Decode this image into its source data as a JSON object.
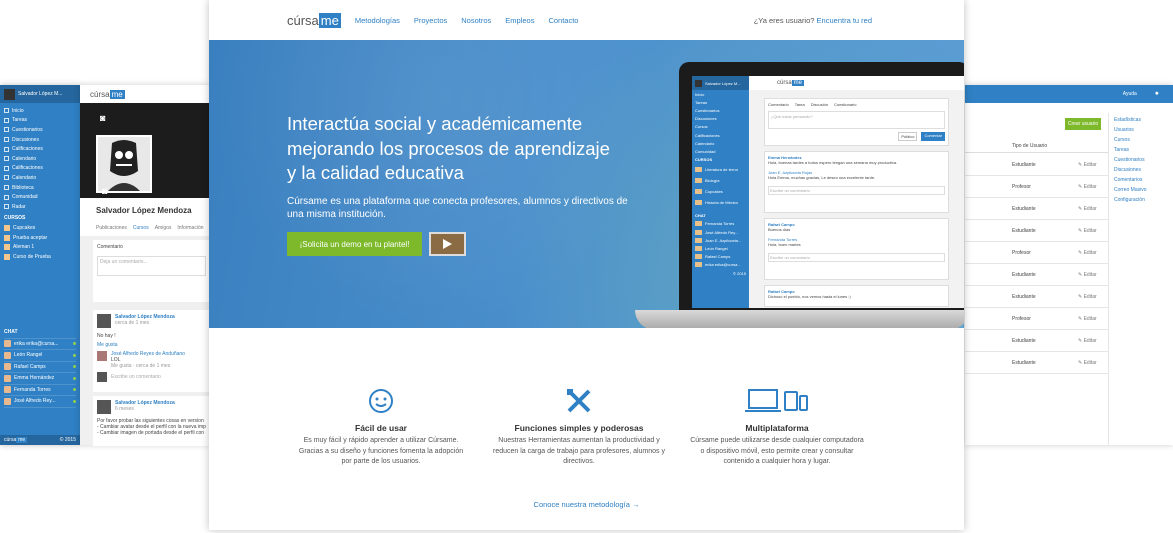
{
  "nav": {
    "logo_text": "cúrsa",
    "logo_badge": "me",
    "links": [
      "Metodologías",
      "Proyectos",
      "Nosotros",
      "Empleos",
      "Contacto"
    ],
    "question": "¿Ya eres usuario?",
    "login_link": "Encuentra tu red"
  },
  "hero": {
    "headline_1": "Interactúa social y académicamente",
    "headline_2": "mejorando los procesos de aprendizaje",
    "headline_3": "y la calidad educativa",
    "sub_1": "Cúrsame es una plataforma que conecta profesores, alumnos y directivos de",
    "sub_2": "una misma institución.",
    "cta": "¡Solicita un demo en tu plantel!"
  },
  "features": [
    {
      "title": "Fácil de usar",
      "l1": "Es muy fácil y rápido aprender a utilizar Cúrsame.",
      "l2": "Gracias a su diseño y funciones fomenta la adopción",
      "l3": "por parte de los usuarios."
    },
    {
      "title": "Funciones simples y poderosas",
      "l1": "Nuestras Herramientas aumentan la productividad y",
      "l2": "reducen la carga de trabajo para profesores, alumnos y",
      "l3": "directivos."
    },
    {
      "title": "Multiplataforma",
      "l1": "Cúrsame puede utilizarse desde cualquier computadora",
      "l2": "o dispositivo móvil, esto permite crear y consultar",
      "l3": "contenido a cualquier hora y lugar."
    }
  ],
  "more_link": "Conoce nuestra metodología →",
  "left_panel": {
    "user": "Salvador López M...",
    "nav": [
      "Inicio",
      "Tareas",
      "Cuestionarios",
      "Discusiones",
      "Calificaciones",
      "Calendario",
      "Calificaciones",
      "Calendario",
      "Biblioteca",
      "Comunidad",
      "Radar"
    ],
    "courses_label": "CURSOS",
    "courses": [
      "Cupcakes",
      "Prueba aceptar",
      "Aleman 1",
      "Curso de Prueba"
    ],
    "chat_label": "CHAT",
    "chat": [
      "erika erika@cursa...",
      "León Rangel",
      "Rafael Camps",
      "Emma Hernández",
      "Fernanda Torres",
      "José Alfredo Rey..."
    ],
    "footer_logo": "cúrsa",
    "footer_badge": "me",
    "footer_year": "© 2015"
  },
  "profile_panel": {
    "logo_text": "cúrsa",
    "logo_badge": "me",
    "name": "Salvador López Mendoza",
    "tabs": [
      "Publicaciones",
      "Cursos",
      "Amigos",
      "Información"
    ],
    "comment_label": "Comentario",
    "comment_placeholder": "Deja un comentario...",
    "post1_author": "Salvador López Mendoza",
    "post1_time": "cerca de 1 mes",
    "post1_text": "No hay !",
    "post1_like": "Me gusta",
    "reply_author": "José Alfredo Reyes de Anduñano",
    "reply_text": "LOL",
    "reply_meta": "Me gusta · cerca de 1 mes",
    "reply_placeholder": "Escribe un comentario",
    "post2_author": "Salvador López Mendoza",
    "post2_time": "6 meses",
    "post2_l1": "Por favor probar las siguientes cosas en version",
    "post2_l2": "- Cambiar avatar desde el perfil con la nueva imp",
    "post2_l3": "- Cambiar imagen de portada desde el perfil con"
  },
  "right_panel": {
    "help": "Ayuda",
    "create_btn": "Crear usuario",
    "col_header": "Tipo de Usuario",
    "rows": [
      "Estudiante",
      "Profesor",
      "Estudiante",
      "Estudiante",
      "Profesor",
      "Estudiante",
      "Estudiante",
      "Profesor",
      "Estudiante",
      "Estudiante"
    ],
    "edit": "Editar",
    "side": [
      "Estadísticas",
      "Usuarios",
      "Cursos",
      "Tareas",
      "Cuestionarios",
      "Discusiones",
      "Comentarios",
      "Correo Masivo",
      "Configuración"
    ]
  },
  "laptop": {
    "user": "Salvador López M...",
    "nav": [
      "Inicio",
      "Tareas",
      "Cuestionarios",
      "Discusiones",
      "Cursos",
      "Calificaciones",
      "Calendario",
      "Comunidad"
    ],
    "courses_label": "CURSOS",
    "courses": [
      "Literatura de terror",
      "Biología",
      "Cupcakes",
      "Historia de México"
    ],
    "chat_label": "CHAT",
    "chat": [
      "Fernanda Torres",
      "José Alfredo Rey...",
      "Juan E. Azpilcueta...",
      "León Rangel",
      "Rafael Camps",
      "erika erika@cursa..."
    ],
    "tabs": [
      "Comentario",
      "Tarea",
      "Discusión",
      "Cuestionario"
    ],
    "placeholder": "¿Qué estas pensando?",
    "public": "Público",
    "send": "Comentar",
    "p1_author": "Emma Hernández",
    "p1_text": "Hola, buenas tardes a todos espero tengan una semana muy productiva.",
    "p1_reply_author": "Juan E. Azpilcueta Rojas",
    "p1_reply_text": "Hola Emma, muchas gracias, Le deseo una excelente tarde.",
    "comment_ph": "Escribe un comentario",
    "p2_author": "Rafael Campo",
    "p2_text": "Buenos días",
    "p2_reply_author": "Fernanda Torres",
    "p2_reply_text": "Hola, buen martes",
    "p3_author": "Rafael Campo",
    "p3_text": "Dichoso el pueblo, nos vemos hasta el lunes :)",
    "footer_year": "© 2015"
  }
}
